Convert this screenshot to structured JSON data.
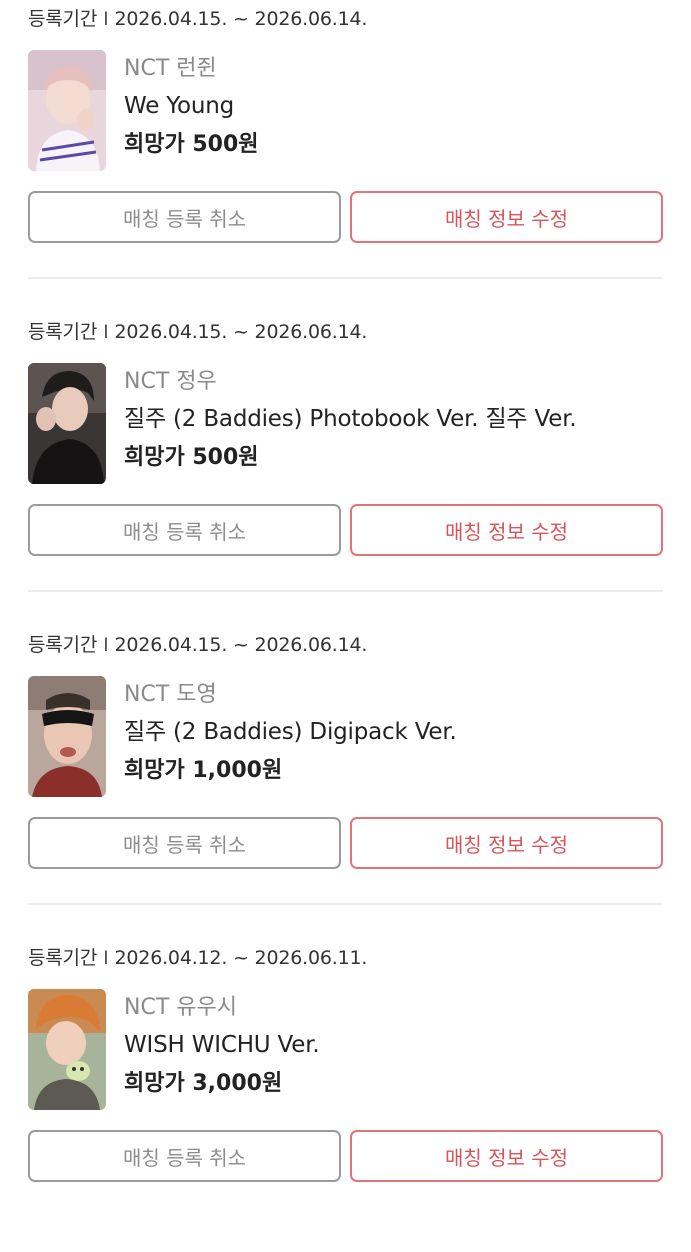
{
  "labels": {
    "period_prefix": "등록기간",
    "period_separator": "I",
    "cancel_button": "매칭 등록 취소",
    "edit_button": "매칭 정보 수정"
  },
  "colors": {
    "accent": "#d9535a",
    "accent_border": "#e07478",
    "muted_border": "#9a9a9a",
    "divider": "#ededed"
  },
  "items": [
    {
      "period": "2026.04.15. ~ 2026.06.14.",
      "group": "NCT 런쥔",
      "title": "We Young",
      "price": "희망가 500원"
    },
    {
      "period": "2026.04.15. ~ 2026.06.14.",
      "group": "NCT 정우",
      "title": "질주 (2 Baddies) Photobook Ver. 질주 Ver.",
      "price": "희망가 500원"
    },
    {
      "period": "2026.04.15. ~ 2026.06.14.",
      "group": "NCT 도영",
      "title": "질주 (2 Baddies) Digipack Ver.",
      "price": "희망가 1,000원"
    },
    {
      "period": "2026.04.12. ~ 2026.06.11.",
      "group": "NCT 유우시",
      "title": "WISH WICHU Ver.",
      "price": "희망가 3,000원"
    }
  ]
}
